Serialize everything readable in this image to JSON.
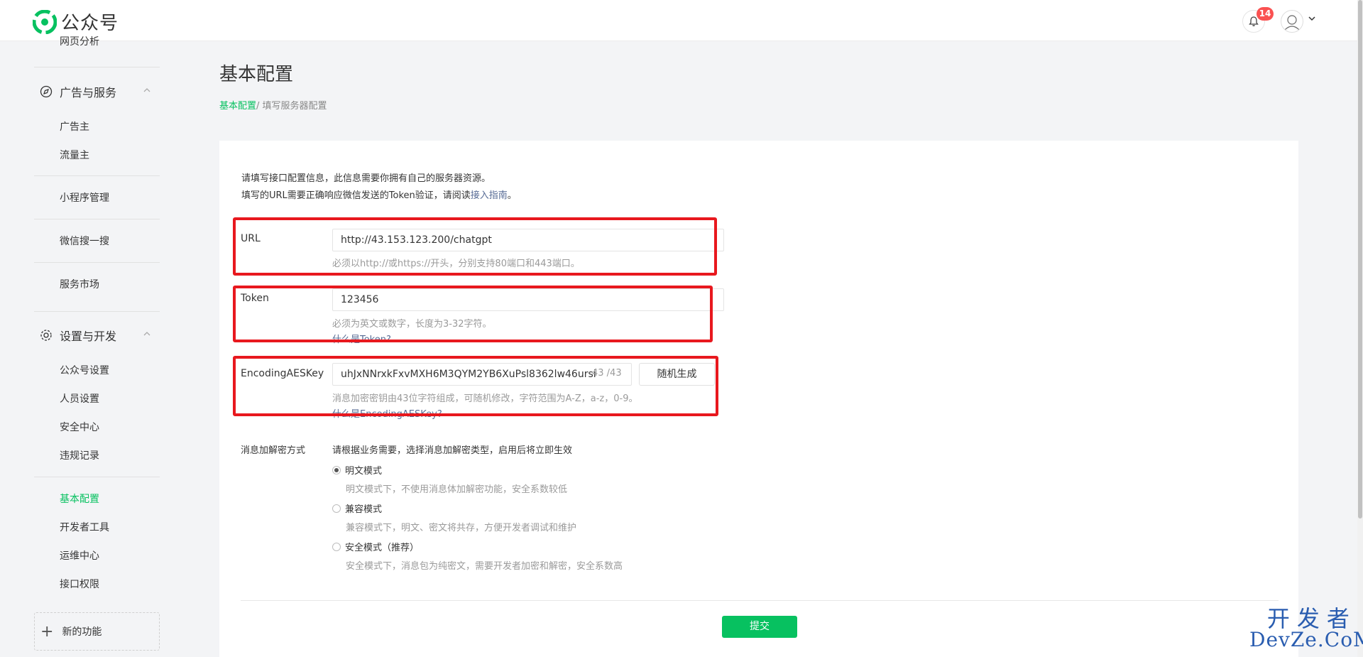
{
  "header": {
    "app_name": "公众号",
    "notification_count": "14"
  },
  "sidebar": {
    "cut_item": "网页分析",
    "groups": [
      {
        "label": "广告与服务",
        "items": [
          "广告主",
          "流量主"
        ]
      },
      {
        "label": "设置与开发",
        "items": [
          "公众号设置",
          "人员设置",
          "安全中心",
          "违规记录"
        ]
      }
    ],
    "single_items": [
      "小程序管理",
      "微信搜一搜",
      "服务市场"
    ],
    "dev_items": [
      "基本配置",
      "开发者工具",
      "运维中心",
      "接口权限"
    ],
    "active": "基本配置",
    "new_feature": "新的功能"
  },
  "main": {
    "title": "基本配置",
    "breadcrumb": {
      "current": "基本配置",
      "sep": "/",
      "next": " 填写服务器配置"
    },
    "desc_line1": "请填写接口配置信息，此信息需要你拥有自己的服务器资源。",
    "desc_line2_pre": "填写的URL需要正确响应微信发送的Token验证，请阅读",
    "desc_link": "接入指南",
    "desc_line2_post": "。",
    "url": {
      "label": "URL",
      "value": "http://43.153.123.200/chatgpt",
      "hint": "必须以http://或https://开头，分别支持80端口和443端口。"
    },
    "token": {
      "label": "Token",
      "value": "123456",
      "hint": "必须为英文或数字，长度为3-32字符。",
      "link": "什么是Token?"
    },
    "aes": {
      "label": "EncodingAESKey",
      "value": "uhJxNNrxkFxvMXH6M3QYM2YB6XuPsl8362lw46ursi",
      "counter": "43 /43",
      "random_button": "随机生成",
      "hint": "消息加密密钥由43位字符组成，可随机修改，字符范围为A-Z，a-z，0-9。",
      "link": "什么是EncodingAESKey?"
    },
    "mode": {
      "label": "消息加解密方式",
      "intro": "请根据业务需要，选择消息加解密类型，启用后将立即生效",
      "options": [
        {
          "label": "明文模式",
          "desc": "明文模式下，不使用消息体加解密功能，安全系数较低",
          "selected": true
        },
        {
          "label": "兼容模式",
          "desc": "兼容模式下，明文、密文将共存，方便开发者调试和维护",
          "selected": false
        },
        {
          "label": "安全模式（推荐）",
          "desc": "安全模式下，消息包为纯密文，需要开发者加密和解密，安全系数高",
          "selected": false
        }
      ]
    },
    "submit": "提交"
  },
  "watermark": {
    "line1": "开发者",
    "line2": "DevZe.CoM"
  },
  "colors": {
    "accent": "#07c160",
    "highlight": "#e8181e",
    "link": "#576b95"
  }
}
